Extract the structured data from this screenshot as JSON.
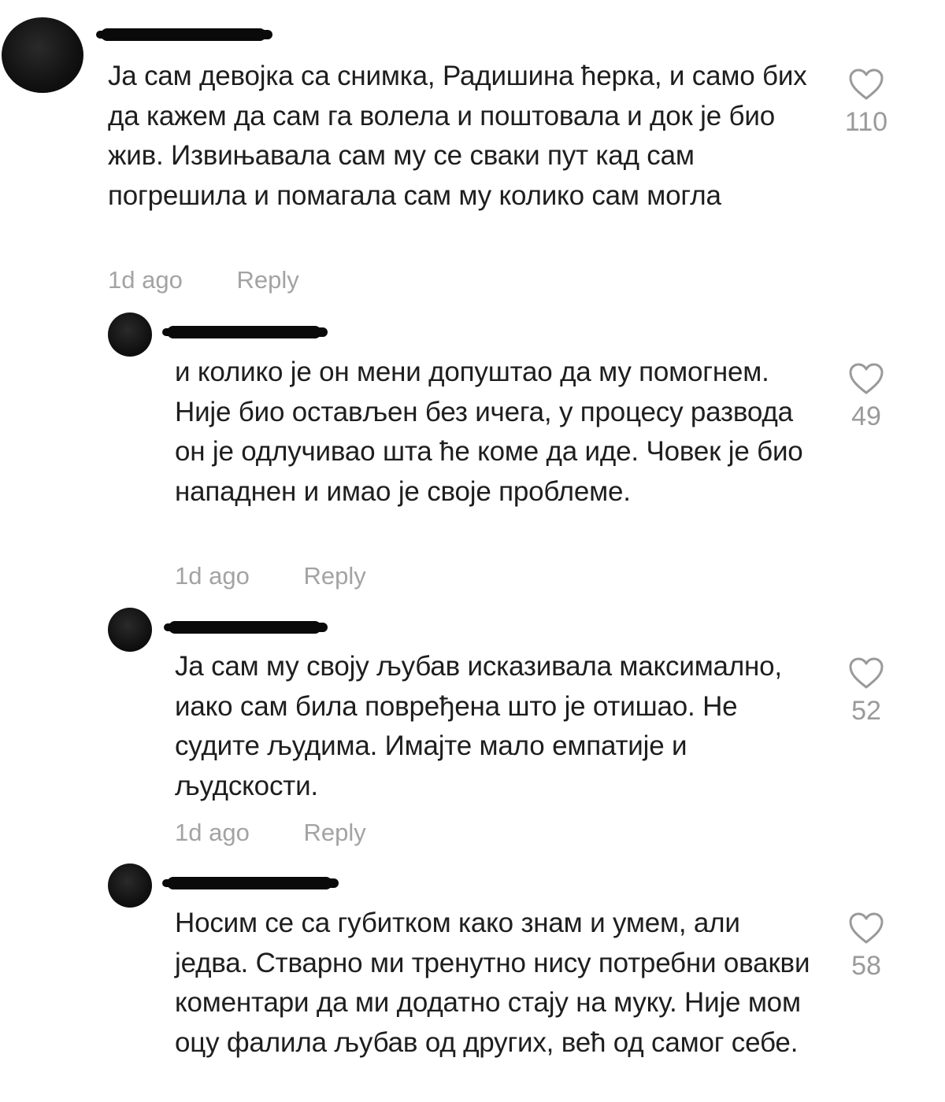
{
  "comments": [
    {
      "text": "Ја сам девојка са снимка, Радишина ћерка, и само бих да кажем да сам га волела и поштовала и док је био жив. Извињавала сам му се сваки пут кад сам погрешила и помагала сам му колико сам могла",
      "time": "1d ago",
      "reply_label": "Reply",
      "likes": "110"
    },
    {
      "text": "и колико је он мени допуштао да му помогнем. Није био остављен без ичега, у процесу развода он је одлучивао шта ће коме да иде. Човек је био нападнен и имао је своје проблеме.",
      "time": "1d ago",
      "reply_label": "Reply",
      "likes": "49"
    },
    {
      "text": "Ја сам му своју љубав исказивала максимално, иако сам била повређена што је отишао. Не судите људима. Имајте мало емпатије и људскости.",
      "time": "1d ago",
      "reply_label": "Reply",
      "likes": "52"
    },
    {
      "text": "Носим се са губитком како знам и умем, али једва. Стварно ми тренутно нису потребни овакви коментари да ми додатно стају на муку. Није мом оцу фалила љубав од других, већ од самог себе.",
      "likes": "58"
    }
  ],
  "icons": {
    "like": "heart-outline-icon",
    "avatar": "redacted-avatar",
    "username": "redacted-username"
  },
  "colors": {
    "text": "#1e1e1e",
    "meta": "#a3a3a3",
    "like_count": "#9a9a9a",
    "redaction": "#0a0a0a"
  }
}
